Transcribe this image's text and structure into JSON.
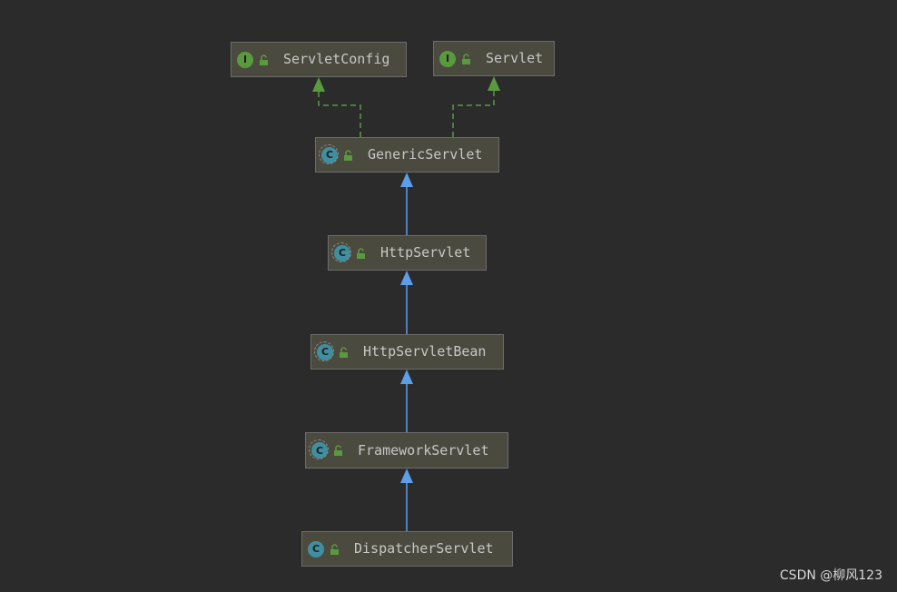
{
  "diagram": {
    "nodes": [
      {
        "id": "servletconfig",
        "label": "ServletConfig",
        "kind": "interface",
        "kind_letter": "I"
      },
      {
        "id": "servlet",
        "label": "Servlet",
        "kind": "interface",
        "kind_letter": "I"
      },
      {
        "id": "genericservlet",
        "label": "GenericServlet",
        "kind": "abstract-class",
        "kind_letter": "C"
      },
      {
        "id": "httpservlet",
        "label": "HttpServlet",
        "kind": "abstract-class",
        "kind_letter": "C"
      },
      {
        "id": "httpservletbean",
        "label": "HttpServletBean",
        "kind": "abstract-class",
        "kind_letter": "C"
      },
      {
        "id": "frameworkservlet",
        "label": "FrameworkServlet",
        "kind": "abstract-class",
        "kind_letter": "C"
      },
      {
        "id": "dispatcherservlet",
        "label": "DispatcherServlet",
        "kind": "class",
        "kind_letter": "C"
      }
    ],
    "edges": [
      {
        "from": "genericservlet",
        "to": "servletconfig",
        "type": "implements"
      },
      {
        "from": "genericservlet",
        "to": "servlet",
        "type": "implements"
      },
      {
        "from": "httpservlet",
        "to": "genericservlet",
        "type": "extends"
      },
      {
        "from": "httpservletbean",
        "to": "httpservlet",
        "type": "extends"
      },
      {
        "from": "frameworkservlet",
        "to": "httpservletbean",
        "type": "extends"
      },
      {
        "from": "dispatcherservlet",
        "to": "frameworkservlet",
        "type": "extends"
      }
    ],
    "colors": {
      "background": "#2b2b2b",
      "node_fill": "#4b4a3f",
      "implements_edge": "#5a9a3f",
      "extends_edge": "#5c9ee8",
      "interface_icon": "#5a9a3f",
      "class_icon": "#3f8fa0",
      "lock_icon": "#5a9a3f"
    },
    "icons": {
      "interface": "interface-icon",
      "class": "class-icon",
      "visibility": "lock-open-icon"
    }
  },
  "watermark": "CSDN @柳风123"
}
